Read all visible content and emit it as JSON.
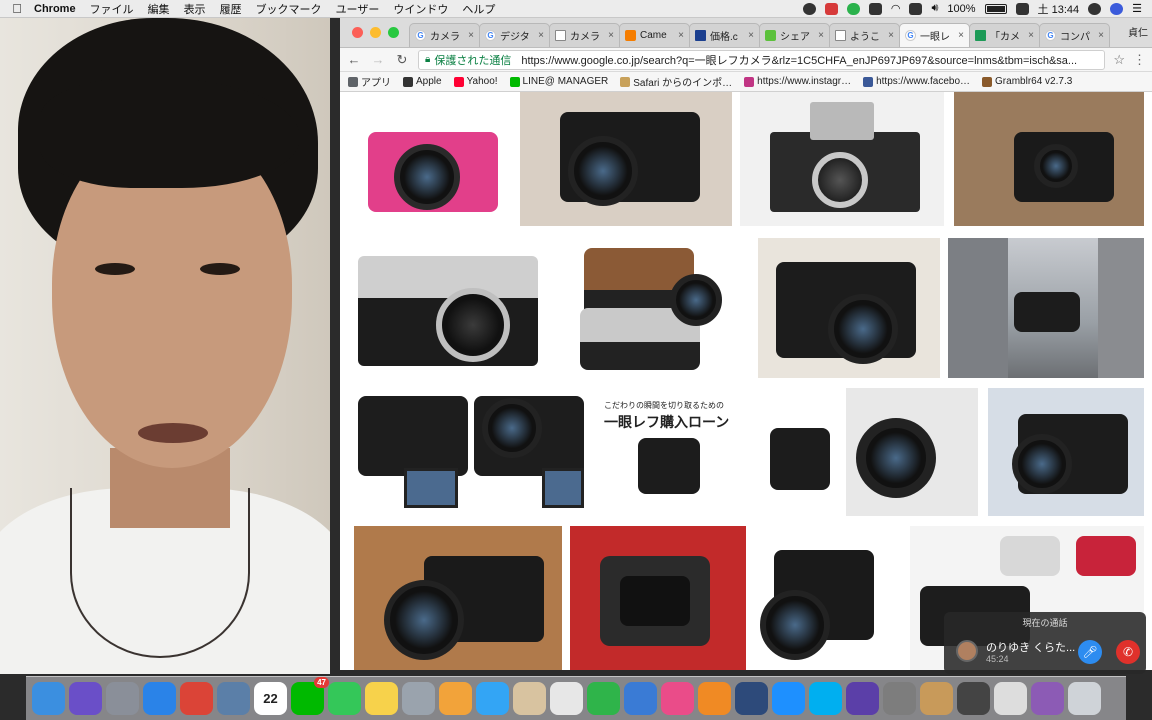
{
  "menubar": {
    "app_name": "Chrome",
    "items": [
      "ファイル",
      "編集",
      "表示",
      "履歴",
      "ブックマーク",
      "ユーザー",
      "ウインドウ",
      "ヘルプ"
    ],
    "battery": "100%",
    "clock": "土 13:44"
  },
  "tabs": [
    {
      "title": "カメラ",
      "icon": "google-icon"
    },
    {
      "title": "デジタ",
      "icon": "google-icon"
    },
    {
      "title": "カメラ",
      "icon": "document-icon"
    },
    {
      "title": "Came",
      "icon": "blogger-icon"
    },
    {
      "title": "価格.c",
      "icon": "kakaku-icon"
    },
    {
      "title": "シェア",
      "icon": "share-icon"
    },
    {
      "title": "ようこ",
      "icon": "document-icon"
    },
    {
      "title": "一眼レ",
      "icon": "google-icon",
      "active": true
    },
    {
      "title": "「カメ",
      "icon": "sheets-icon"
    },
    {
      "title": "コンパ",
      "icon": "google-icon"
    }
  ],
  "profile_label": "貞仁",
  "address": {
    "secure_label": "保護された通信",
    "url": "https://www.google.co.jp/search?q=一眼レフカメラ&rlz=1C5CHFA_enJP697JP697&source=lnms&tbm=isch&sa..."
  },
  "bookmarks": [
    {
      "label": "アプリ",
      "color": "#5f6368"
    },
    {
      "label": "Apple",
      "color": "#333333"
    },
    {
      "label": "Yahoo!",
      "color": "#ff0033"
    },
    {
      "label": "LINE@ MANAGER",
      "color": "#00b900"
    },
    {
      "label": "Safari からのインポ…",
      "color": "#c8a15a"
    },
    {
      "label": "https://www.instagr…",
      "color": "#c13584"
    },
    {
      "label": "https://www.facebo…",
      "color": "#3b5998"
    },
    {
      "label": "Gramblr64 v2.7.3",
      "color": "#8a5a2b"
    }
  ],
  "results": {
    "loan_sub": "こだわりの瞬間を切り取るための",
    "loan_title": "一眼レフ購入ローン"
  },
  "call": {
    "header": "現在の通話",
    "name": "のりゆき くらた...",
    "duration": "45:24"
  },
  "dock": [
    {
      "name": "finder-icon",
      "color": "#3b8fe0"
    },
    {
      "name": "siri-icon",
      "color": "#6a4fc8"
    },
    {
      "name": "launchpad-icon",
      "color": "#8a8f99"
    },
    {
      "name": "safari-icon",
      "color": "#2a83e8"
    },
    {
      "name": "chrome-icon",
      "color": "#db4437"
    },
    {
      "name": "preview-icon",
      "color": "#5b7fa8"
    },
    {
      "name": "calendar-icon",
      "color": "#ffffff",
      "text": "22"
    },
    {
      "name": "line-icon",
      "color": "#00b900",
      "badge": "47"
    },
    {
      "name": "facetime-icon",
      "color": "#34c759"
    },
    {
      "name": "notes-icon",
      "color": "#f7d24b"
    },
    {
      "name": "image-capture-icon",
      "color": "#9aa3ad"
    },
    {
      "name": "photos-icon",
      "color": "#f2a33a"
    },
    {
      "name": "messages-icon",
      "color": "#33a5f5"
    },
    {
      "name": "contacts-icon",
      "color": "#d8c3a0"
    },
    {
      "name": "textedit-icon",
      "color": "#e7e7e7"
    },
    {
      "name": "numbers-icon",
      "color": "#2fb44a"
    },
    {
      "name": "keynote-icon",
      "color": "#3a7bd5"
    },
    {
      "name": "itunes-icon",
      "color": "#ea4c89"
    },
    {
      "name": "ibooks-icon",
      "color": "#f08a24"
    },
    {
      "name": "quicktime-icon",
      "color": "#2d4a7a"
    },
    {
      "name": "appstore-icon",
      "color": "#1e90ff"
    },
    {
      "name": "skype-icon",
      "color": "#00aff0"
    },
    {
      "name": "imovie-icon",
      "color": "#5b3fa8"
    },
    {
      "name": "system-preferences-icon",
      "color": "#7d7d7d"
    },
    {
      "name": "archive-icon",
      "color": "#c89a5a"
    },
    {
      "name": "screenshot-app-icon",
      "color": "#444444"
    },
    {
      "name": "document-icon",
      "color": "#dddddd"
    },
    {
      "name": "stack-icon",
      "color": "#8c5bb5"
    },
    {
      "name": "trash-icon",
      "color": "#cfd3d8"
    }
  ]
}
